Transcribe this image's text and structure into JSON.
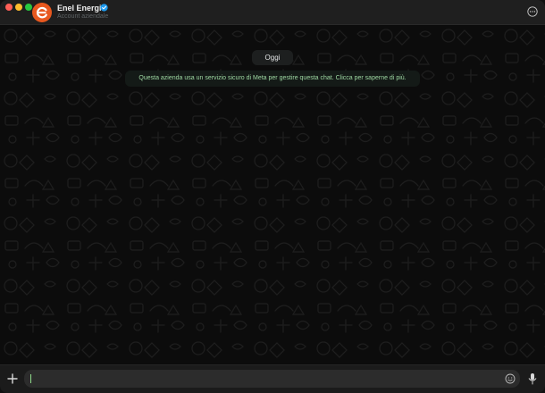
{
  "header": {
    "contact_name": "Enel Energia",
    "contact_subtitle": "Account aziendale",
    "avatar_icon": "enel-logo-icon",
    "verified_icon": "verified-badge-icon",
    "menu_icon": "more-options-icon"
  },
  "chat": {
    "day_label": "Oggi",
    "system_message": "Questa azienda usa un servizio sicuro di Meta per gestire questa chat. Clicca per saperne di più."
  },
  "composer": {
    "input_value": "",
    "input_placeholder": "",
    "attach_icon": "plus-icon",
    "emoji_icon": "emoji-icon",
    "mic_icon": "microphone-icon"
  },
  "colors": {
    "brand": "#e8581f",
    "system_text": "#9ed8a2",
    "background": "#0c0c0c"
  }
}
